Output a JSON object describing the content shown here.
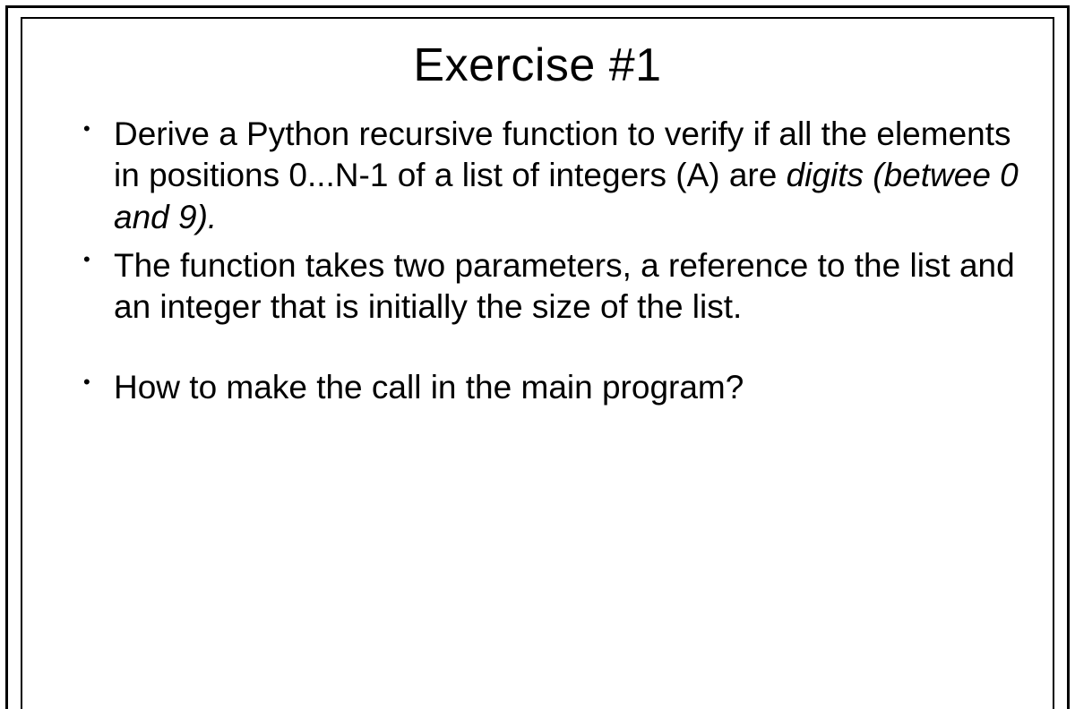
{
  "title": "Exercise #1",
  "bullets": {
    "b1_part1": "Derive a Python recursive function to verify if all the elements in positions 0...N-1 of a list of integers (A) are ",
    "b1_italic": "digits (betwee 0 and 9).",
    "b2": "The function takes two parameters, a reference to the list and an integer that is initially the size of the list.",
    "b3": "How to make the call in the main program?"
  }
}
